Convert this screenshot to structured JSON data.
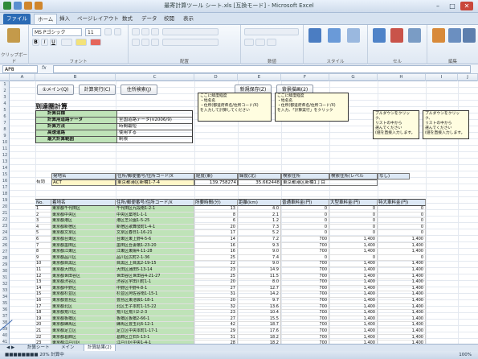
{
  "window": {
    "title": "最寄計算ツール シート.xls [互換モード] - Microsoft Excel"
  },
  "ribbon": {
    "tabs": [
      "ファイル",
      "ホーム",
      "挿入",
      "ページレイアウト",
      "数式",
      "データ",
      "校閲",
      "表示"
    ],
    "font_name": "MS Pゴシック",
    "font_size": "11",
    "groups": [
      "クリップボード",
      "フォント",
      "配置",
      "数値",
      "スタイル",
      "セル",
      "編集"
    ]
  },
  "formula_bar": {
    "name_box": "AP8",
    "fx": "fx",
    "value": ""
  },
  "columns": [
    "A",
    "B",
    "C",
    "D",
    "E",
    "F",
    "G",
    "H",
    "I",
    "J"
  ],
  "buttons": {
    "main": "①メイン(Q)",
    "calc": "計算実行(C)",
    "search": "住所検索(J)",
    "save": "新規保存(Z)",
    "sort": "背景描画(2)"
  },
  "section_title": "到達圏計算",
  "settings": [
    {
      "label": "計算目標",
      "value": ""
    },
    {
      "label": "計算用道路データ",
      "value": "全国道路データ(V2006/9)"
    },
    {
      "label": "計算方法",
      "value": "時間最短"
    },
    {
      "label": "高速道路",
      "value": "使用する"
    },
    {
      "label": "最大計算範囲",
      "value": "制限"
    }
  ],
  "notes": [
    "ここに緯度経度\n・地名名\n・住所(都道府県名/住所コード/X)\nを入力して計算してください",
    "ここに緯度経度\n・地名名\n・住所(都道府県名/住所コード/X)\nを入力、「計算実行」をクリック",
    "プルダウンをクリック、\nリストの中から\n選んでください\n(値を直接入力します。",
    "プルダウンをクリック、\nリストの中から\n選んでください\n(値を直接入力します。"
  ],
  "origin": {
    "headers": [
      "発地名",
      "住所/郵便番号/住所コード/X",
      "経度(東)",
      "緯度(北)",
      "検索住所",
      "検索住所(レベル",
      "なし)"
    ],
    "label": "有効",
    "name": "ACT",
    "address": "東京都港区新橋1-7-4",
    "lon": "139.758274",
    "lat": "35.662448",
    "found": "東京都港区新橋1丁目"
  },
  "table": {
    "headers": [
      "No.",
      "着地名",
      "住所/郵便番号/住所コード/X",
      "所要時間(分)",
      "距離(km)",
      "普通車料金(円)",
      "大型車料金(円)",
      "特大車料金(円)"
    ],
    "rows": [
      [
        "1",
        "東京都千代田区",
        "千代田区九段南1-2-1",
        "13",
        "4.0",
        "0",
        "0",
        "0"
      ],
      [
        "2",
        "東京都中央区",
        "中央区築地1-1-1",
        "8",
        "2.1",
        "0",
        "0",
        "0"
      ],
      [
        "3",
        "東京都港区",
        "港区芝公園1-5-25",
        "6",
        "1.2",
        "0",
        "0",
        "0"
      ],
      [
        "4",
        "東京都新宿区",
        "新宿区歌舞伎町1-4-1",
        "20",
        "7.3",
        "0",
        "0",
        "0"
      ],
      [
        "5",
        "東京都文京区",
        "文京区春日1-16-21",
        "17",
        "5.2",
        "0",
        "0",
        "0"
      ],
      [
        "6",
        "東京都台東区",
        "台東区東上野4-5-6",
        "14",
        "7.2",
        "700",
        "1,400",
        "1,400"
      ],
      [
        "7",
        "東京都墨田区",
        "墨田区吾妻橋1-23-20",
        "16",
        "9.3",
        "700",
        "1,400",
        "1,400"
      ],
      [
        "8",
        "東京都江東区",
        "江東区東陽4-11-28",
        "16",
        "9.0",
        "700",
        "1,400",
        "1,400"
      ],
      [
        "9",
        "東京都品川区",
        "品川区広町2-1-36",
        "25",
        "7.4",
        "0",
        "0",
        "0"
      ],
      [
        "10",
        "東京都目黒区",
        "目黒区上目黒2-19-15",
        "22",
        "9.0",
        "700",
        "1,400",
        "1,400"
      ],
      [
        "11",
        "東京都大田区",
        "大田区蒲田5-13-14",
        "23",
        "14.9",
        "700",
        "1,400",
        "1,400"
      ],
      [
        "12",
        "東京都世田谷区",
        "世田谷区世田谷4-21-27",
        "25",
        "11.5",
        "700",
        "1,400",
        "1,400"
      ],
      [
        "13",
        "東京都渋谷区",
        "渋谷区宇田川町1-1",
        "20",
        "8.0",
        "700",
        "1,400",
        "1,400"
      ],
      [
        "14",
        "東京都中野区",
        "中野区中野4-8-1",
        "27",
        "12.7",
        "700",
        "1,400",
        "1,400"
      ],
      [
        "15",
        "東京都杉並区",
        "杉並区阿佐谷南1-15-1",
        "31",
        "14.2",
        "700",
        "1,400",
        "1,400"
      ],
      [
        "16",
        "東京都豊島区",
        "豊島区東池袋1-18-1",
        "20",
        "9.7",
        "700",
        "1,400",
        "1,400"
      ],
      [
        "17",
        "東京都北区",
        "北区王子本町1-15-22",
        "32",
        "13.6",
        "700",
        "1,400",
        "1,400"
      ],
      [
        "18",
        "東京都荒川区",
        "荒川区荒川2-2-3",
        "23",
        "10.4",
        "700",
        "1,400",
        "1,400"
      ],
      [
        "19",
        "東京都板橋区",
        "板橋区板橋2-66-1",
        "27",
        "15.5",
        "700",
        "1,400",
        "1,400"
      ],
      [
        "20",
        "東京都練馬区",
        "練馬区豊玉北6-12-1",
        "42",
        "18.7",
        "700",
        "1,400",
        "1,400"
      ],
      [
        "21",
        "東京都足立区",
        "足立区中央本町1-17-1",
        "29",
        "17.6",
        "700",
        "1,400",
        "1,400"
      ],
      [
        "22",
        "東京都葛飾区",
        "葛飾区立石5-13-1",
        "31",
        "18.2",
        "700",
        "1,400",
        "1,400"
      ],
      [
        "23",
        "東京都江戸川区",
        "江戸川区中央1-4-1",
        "28",
        "18.2",
        "700",
        "1,400",
        "1,400"
      ]
    ]
  },
  "sheet_tabs": [
    "計算シート",
    "メイン",
    "計算結果(2)"
  ],
  "status": {
    "left": "■■■■■■■■ 20% 計算中",
    "zoom": "100%"
  }
}
